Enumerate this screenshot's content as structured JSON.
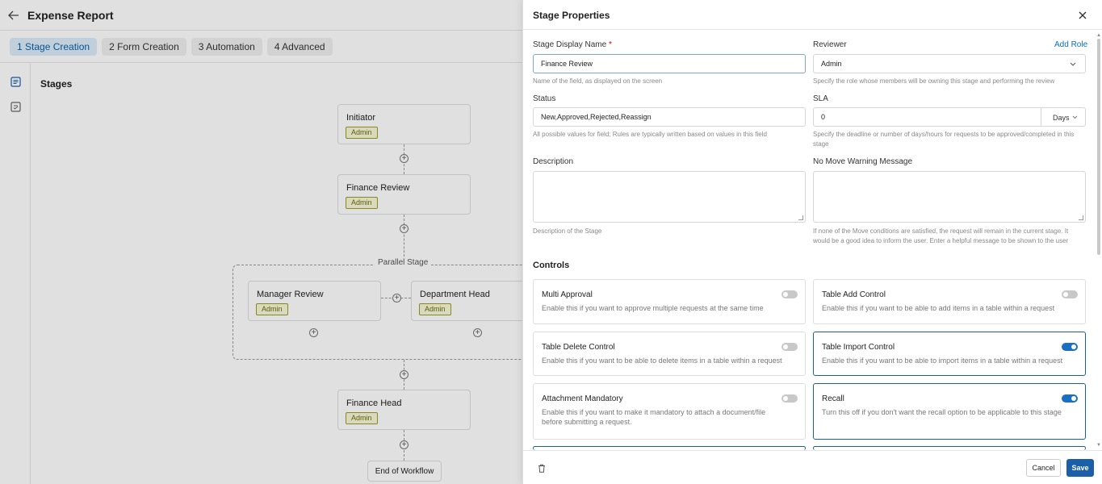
{
  "app": {
    "title": "Expense Report",
    "steps": [
      {
        "label": "1 Stage Creation",
        "active": true
      },
      {
        "label": "2 Form Creation",
        "active": false
      },
      {
        "label": "3 Automation",
        "active": false
      },
      {
        "label": "4 Advanced",
        "active": false
      }
    ],
    "canvas": {
      "title": "Stages",
      "parallel_label": "Parallel Stage",
      "end_label": "End of Workflow",
      "nodes": [
        {
          "label": "Initiator",
          "badge": "Admin"
        },
        {
          "label": "Finance Review",
          "badge": "Admin"
        },
        {
          "label": "Manager Review",
          "badge": "Admin"
        },
        {
          "label": "Department Head",
          "badge": "Admin"
        },
        {
          "label": "Finance Head",
          "badge": "Admin"
        }
      ]
    }
  },
  "drawer": {
    "title": "Stage Properties",
    "stage_name": {
      "label": "Stage Display Name",
      "required_mark": "*",
      "value": "Finance Review",
      "hint": "Name of the field, as displayed on the screen"
    },
    "reviewer": {
      "label": "Reviewer",
      "add_role": "Add Role",
      "value": "Admin",
      "hint": "Specify the role whose members will be owning this stage and performing the review"
    },
    "status": {
      "label": "Status",
      "value": "New,Approved,Rejected,Reassign",
      "hint": "All possible values for field; Rules are typically written based on values in this field"
    },
    "sla": {
      "label": "SLA",
      "value": "0",
      "unit": "Days",
      "hint": "Specify the deadline or number of days/hours for requests to be approved/completed in this stage"
    },
    "description": {
      "label": "Description",
      "value": "",
      "hint": "Description of the Stage"
    },
    "no_move": {
      "label": "No Move Warning Message",
      "value": "",
      "hint": "If none of the Move conditions are satisfied, the request will remain in the current stage. It would be a good idea to inform the user. Enter a helpful message to be shown to the user"
    },
    "controls_title": "Controls",
    "controls": [
      {
        "title": "Multi Approval",
        "desc": "Enable this if you want to approve multiple requests at the same time",
        "enabled": false
      },
      {
        "title": "Table Add Control",
        "desc": "Enable this if you want to be able to add items in a table within a request",
        "enabled": false
      },
      {
        "title": "Table Delete Control",
        "desc": "Enable this if you want to be able to delete items in a table within a request",
        "enabled": false
      },
      {
        "title": "Table Import Control",
        "desc": "Enable this if you want to be able to import items in a table within a request",
        "enabled": true
      },
      {
        "title": "Attachment Mandatory",
        "desc": "Enable this if you want to make it mandatory to attach a document/file before submitting a request.",
        "enabled": false
      },
      {
        "title": "Recall",
        "desc": "Turn this off if you don't want the recall option to be applicable to this stage",
        "enabled": true
      }
    ],
    "footer": {
      "cancel_label": "Cancel",
      "save_label": "Save"
    },
    "colors": {
      "accent": "#1a5fa8",
      "toggle_on": "#1a6fc2",
      "required": "#dd0000"
    }
  }
}
